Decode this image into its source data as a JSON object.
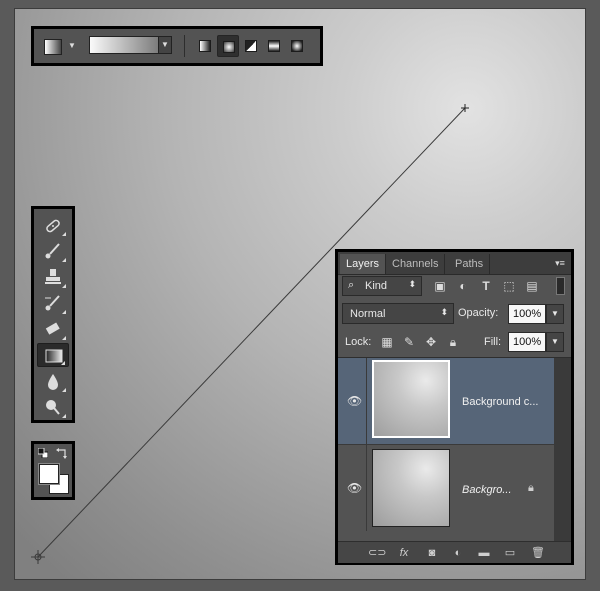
{
  "options_bar": {
    "swatch_icon": "gradient-preset-swatch-icon",
    "gradient_picker_icon": "gradient-picker-icon",
    "gradient_types": [
      {
        "name": "linear-gradient-icon",
        "selected": false
      },
      {
        "name": "radial-gradient-icon",
        "selected": true
      },
      {
        "name": "angle-gradient-icon",
        "selected": false
      },
      {
        "name": "reflected-gradient-icon",
        "selected": false
      },
      {
        "name": "diamond-gradient-icon",
        "selected": false
      }
    ]
  },
  "tools": [
    {
      "name": "spot-healing-brush-icon",
      "selected": false
    },
    {
      "name": "brush-icon",
      "selected": false
    },
    {
      "name": "clone-stamp-icon",
      "selected": false
    },
    {
      "name": "history-brush-icon",
      "selected": false
    },
    {
      "name": "eraser-icon",
      "selected": false
    },
    {
      "name": "gradient-tool-icon",
      "selected": true
    },
    {
      "name": "blur-icon",
      "selected": false
    },
    {
      "name": "dodge-icon",
      "selected": false
    }
  ],
  "colors": {
    "default_colors_icon": "default-colors-icon",
    "swap_colors_icon": "swap-colors-icon",
    "foreground": "#ffffff",
    "background": "#ffffff"
  },
  "layers_panel": {
    "tabs": [
      "Layers",
      "Channels",
      "Paths"
    ],
    "active_tab": "Layers",
    "filter_label": "Kind",
    "filter_icons": [
      "image-filter-icon",
      "adjustment-filter-icon",
      "type-filter-icon",
      "shape-filter-icon",
      "smart-object-filter-icon"
    ],
    "blend_mode": "Normal",
    "opacity_label": "Opacity:",
    "opacity_value": "100%",
    "lock_label": "Lock:",
    "lock_icons": [
      "lock-transparent-icon",
      "lock-image-icon",
      "lock-position-icon",
      "lock-all-icon"
    ],
    "fill_label": "Fill:",
    "fill_value": "100%",
    "layers": [
      {
        "name": "Background c...",
        "selected": true,
        "visible": true,
        "locked": false
      },
      {
        "name": "Backgro...",
        "selected": false,
        "visible": true,
        "locked": true
      }
    ],
    "footer_icons": [
      "link-layers-icon",
      "fx-icon",
      "add-mask-icon",
      "adjustment-layer-icon",
      "new-group-icon",
      "new-layer-icon",
      "trash-icon"
    ],
    "fx_label": "fx"
  },
  "accent": "#566578"
}
